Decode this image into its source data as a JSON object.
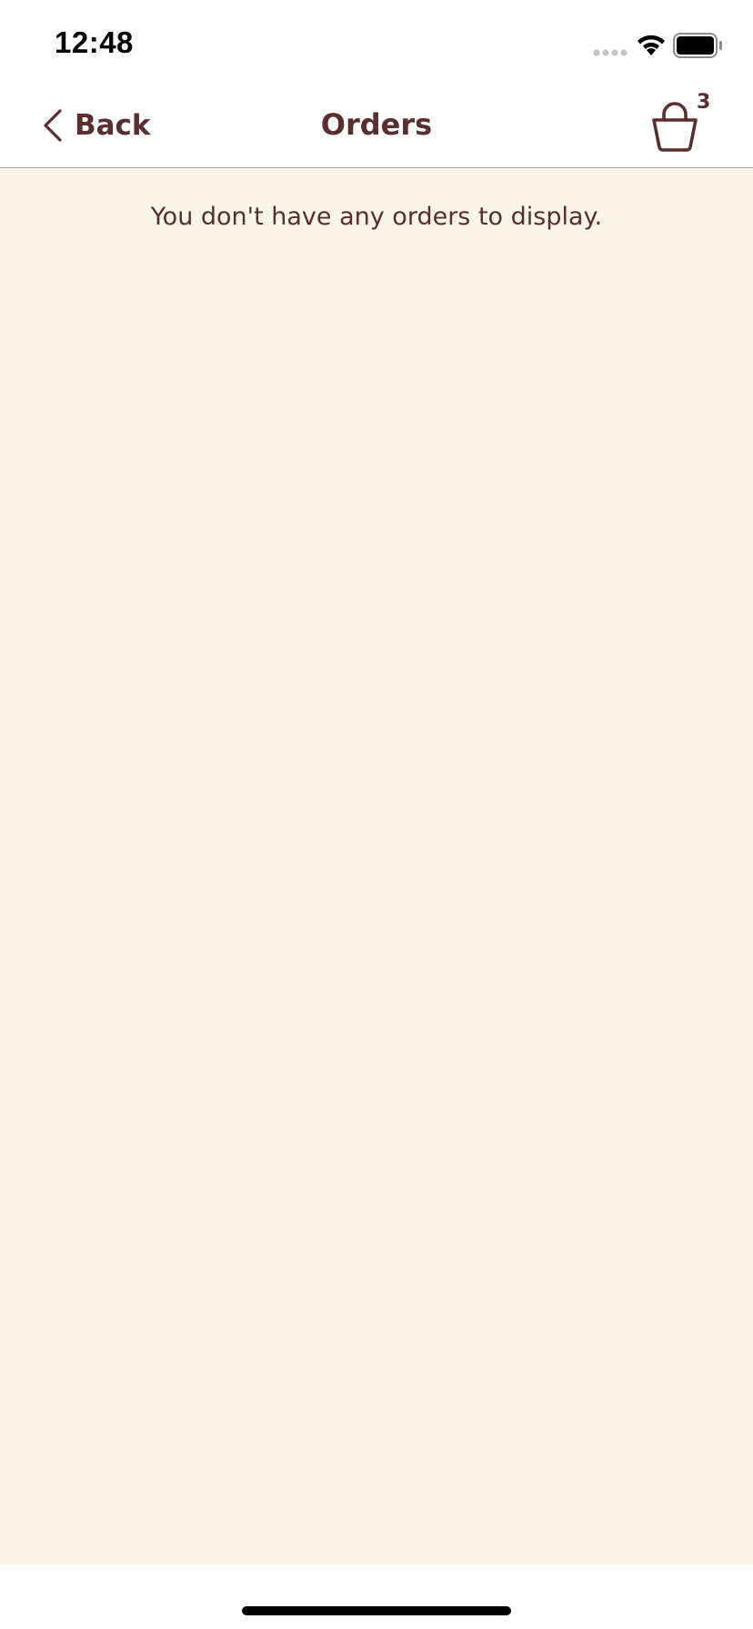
{
  "status_bar": {
    "time": "12:48"
  },
  "nav": {
    "back_label": "Back",
    "title": "Orders",
    "cart_count": "3"
  },
  "content": {
    "empty_message": "You don't have any orders to display."
  },
  "colors": {
    "brand_text": "#5a2e2e",
    "content_background": "#f9f6e7",
    "divider": "#b8a89a"
  },
  "icons": {
    "back": "chevron-left-icon",
    "cart": "basket-icon",
    "signal": "cellular-signal-icon",
    "wifi": "wifi-icon",
    "battery": "battery-icon"
  }
}
